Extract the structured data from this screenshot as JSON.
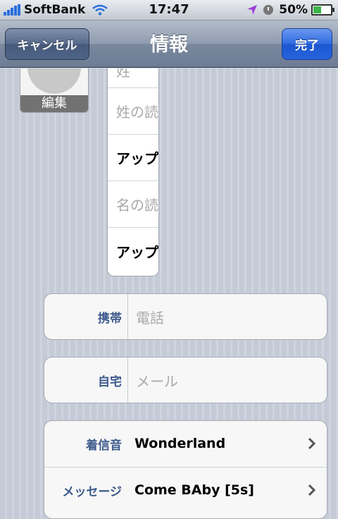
{
  "status_bar": {
    "carrier": "SoftBank",
    "time": "17:47",
    "battery_percent": "50%",
    "battery_level": 0.5,
    "signal_icon": "signal-bars-icon",
    "wifi_icon": "wifi-icon",
    "location_icon": "location-arrow-icon",
    "alarm_icon": "clock-icon"
  },
  "nav": {
    "title": "情報",
    "cancel_label": "キャンセル",
    "done_label": "完了"
  },
  "photo": {
    "edit_label": "編集"
  },
  "name_fields": [
    {
      "text": "姓",
      "kind": "placeholder"
    },
    {
      "text": "姓の読",
      "kind": "placeholder"
    },
    {
      "text": "アップ",
      "kind": "value"
    },
    {
      "text": "名の読",
      "kind": "placeholder"
    },
    {
      "text": "アップ",
      "kind": "value"
    }
  ],
  "phone": {
    "label": "携帯",
    "placeholder": "電話"
  },
  "email": {
    "label": "自宅",
    "placeholder": "メール"
  },
  "settings": [
    {
      "label": "着信音",
      "value": "Wonderland"
    },
    {
      "label": "メッセージ",
      "value": "Come BAby [5s]"
    }
  ],
  "colors": {
    "accent": "#2f6ae0",
    "label_blue": "#3d5a8c",
    "navbar": "#7a889e"
  }
}
